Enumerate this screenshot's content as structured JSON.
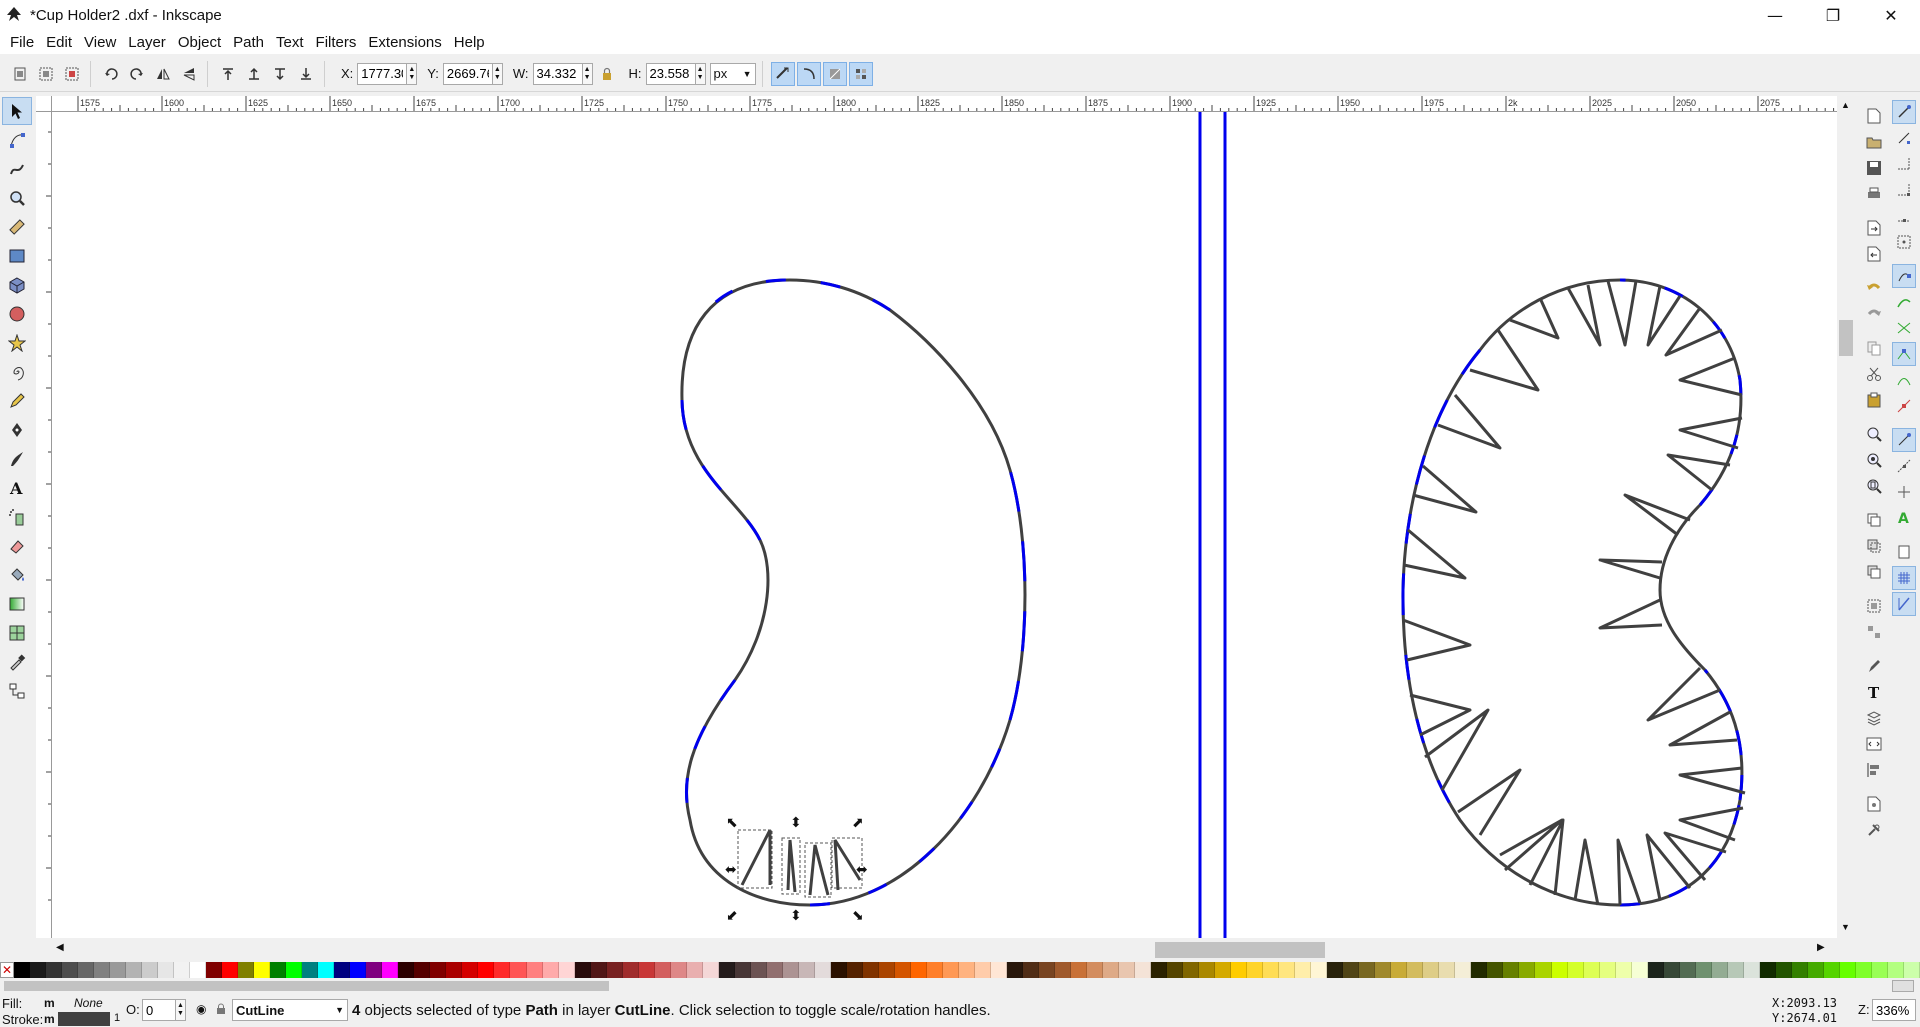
{
  "window": {
    "title": "*Cup Holder2 .dxf - Inkscape",
    "minimize": "—",
    "maximize": "❐",
    "close": "✕"
  },
  "menu": [
    "File",
    "Edit",
    "View",
    "Layer",
    "Object",
    "Path",
    "Text",
    "Filters",
    "Extensions",
    "Help"
  ],
  "controls": {
    "x_label": "X:",
    "x_value": "1777.30",
    "y_label": "Y:",
    "y_value": "2669.76",
    "w_label": "W:",
    "w_value": "34.332",
    "h_label": "H:",
    "h_value": "23.558",
    "unit": "px"
  },
  "ruler": {
    "top_labels": [
      "1575",
      "1600",
      "1625",
      "1650",
      "1675",
      "1700",
      "1725",
      "1750",
      "1775",
      "1800",
      "1825",
      "1850",
      "1875",
      "1900",
      "1925",
      "1950",
      "1975",
      "2k",
      "2025",
      "2050",
      "2075",
      "2"
    ]
  },
  "status": {
    "fill_label": "Fill:",
    "fill_value": "m",
    "fill_none": "None",
    "stroke_label": "Stroke:",
    "stroke_value": "m",
    "stroke_width": "1",
    "opacity_label": "O:",
    "opacity_value": "0",
    "layer": "CutLine",
    "message_count": "4",
    "message_1": " objects selected of type ",
    "message_type": "Path",
    "message_2": " in layer ",
    "message_layer": "CutLine",
    "message_3": ". Click selection to toggle scale/rotation handles.",
    "cursor_x": "X:2093.13",
    "cursor_y": "Y:2674.01",
    "zoom_label": "Z:",
    "zoom_value": "336%"
  },
  "colors": {
    "outline": "#404040",
    "cut_blue": "#0000ee",
    "snap_active": "#c8ddf2"
  },
  "palette": [
    "#000000",
    "#1a1a1a",
    "#333333",
    "#4d4d4d",
    "#666666",
    "#808080",
    "#999999",
    "#b3b3b3",
    "#cccccc",
    "#e6e6e6",
    "#f2f2f2",
    "#ffffff",
    "#800000",
    "#ff0000",
    "#808000",
    "#ffff00",
    "#008000",
    "#00ff00",
    "#008080",
    "#00ffff",
    "#000080",
    "#0000ff",
    "#800080",
    "#ff00ff",
    "#2b0000",
    "#550000",
    "#800000",
    "#aa0000",
    "#d40000",
    "#ff0000",
    "#ff2a2a",
    "#ff5555",
    "#ff8080",
    "#ffaaaa",
    "#ffd5d5",
    "#280b0b",
    "#501616",
    "#782121",
    "#a02c2c",
    "#c83737",
    "#d35f5f",
    "#de8787",
    "#e9afaf",
    "#f4d7d7",
    "#241c1c",
    "#483737",
    "#6c5353",
    "#916f6f",
    "#ac9393",
    "#c8b7b7",
    "#e3dbdb",
    "#2b1100",
    "#552200",
    "#803300",
    "#aa4400",
    "#d45500",
    "#ff6600",
    "#ff7f2a",
    "#ff9955",
    "#ffb380",
    "#ffccaa",
    "#ffe6d5",
    "#28170b",
    "#502d16",
    "#784421",
    "#a05a2c",
    "#c87137",
    "#d38d5f",
    "#deaa87",
    "#e9c6af",
    "#f4e3d7",
    "#2b2200",
    "#554400",
    "#806600",
    "#aa8800",
    "#d4aa00",
    "#ffcc00",
    "#ffd42a",
    "#ffdd55",
    "#ffe680",
    "#ffeeaa",
    "#fff6d5",
    "#28220b",
    "#504416",
    "#786721",
    "#a0892c",
    "#c8ab37",
    "#d3bc5f",
    "#decd87",
    "#e9ddaf",
    "#f4eed7",
    "#222b00",
    "#445500",
    "#668000",
    "#88aa00",
    "#aad400",
    "#ccff00",
    "#d4ff2a",
    "#ddff55",
    "#e5ff80",
    "#eeffaa",
    "#f6ffd5",
    "#1c241c",
    "#374837",
    "#536c53",
    "#6f916f",
    "#93ac93",
    "#b7c8b7",
    "#dbe3db",
    "#112b00",
    "#225500",
    "#338000",
    "#44aa00",
    "#55d400",
    "#66ff00",
    "#7fff2a",
    "#99ff55",
    "#b3ff80",
    "#ccffaa"
  ]
}
